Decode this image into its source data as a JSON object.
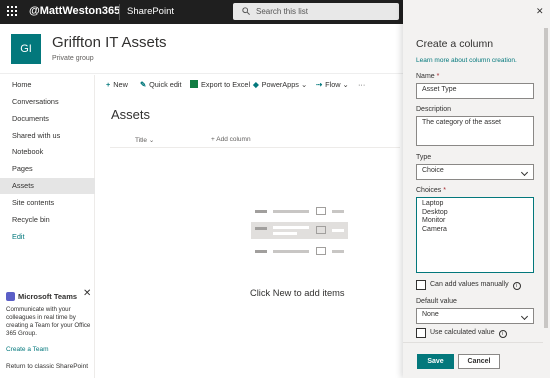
{
  "suite": {
    "handle": "@MattWeston365",
    "app": "SharePoint",
    "search_placeholder": "Search this list"
  },
  "site": {
    "logo": "GI",
    "title": "Griffton IT Assets",
    "subtitle": "Private group"
  },
  "nav": {
    "items": [
      "Home",
      "Conversations",
      "Documents",
      "Shared with us",
      "Notebook",
      "Pages",
      "Assets",
      "Site contents",
      "Recycle bin",
      "Edit"
    ],
    "selected": "Assets"
  },
  "teams": {
    "title": "Microsoft Teams",
    "body": "Communicate with your colleagues in real time by creating a Team for your Office 365 Group.",
    "link": "Create a Team"
  },
  "classic": "Return to classic SharePoint",
  "commands": {
    "new": "New",
    "quick_edit": "Quick edit",
    "export": "Export to Excel",
    "powerapps": "PowerApps",
    "flow": "Flow",
    "more": "···"
  },
  "list": {
    "title": "Assets",
    "col_title": "Title",
    "add_column": "Add column",
    "empty": "Click New to add items"
  },
  "panel": {
    "title": "Create a column",
    "learn": "Learn more about column creation.",
    "name_label": "Name",
    "name_value": "Asset Type",
    "desc_label": "Description",
    "desc_value": "The category of the asset",
    "type_label": "Type",
    "type_value": "Choice",
    "choices_label": "Choices",
    "choices": [
      "Laptop",
      "Desktop",
      "Monitor",
      "Camera"
    ],
    "manual_label": "Can add values manually",
    "default_label": "Default value",
    "default_value": "None",
    "calc_label": "Use calculated value",
    "save": "Save",
    "cancel": "Cancel",
    "required": "*"
  },
  "colors": {
    "accent": "#03787c",
    "suitebar": "#1f1f1f"
  }
}
